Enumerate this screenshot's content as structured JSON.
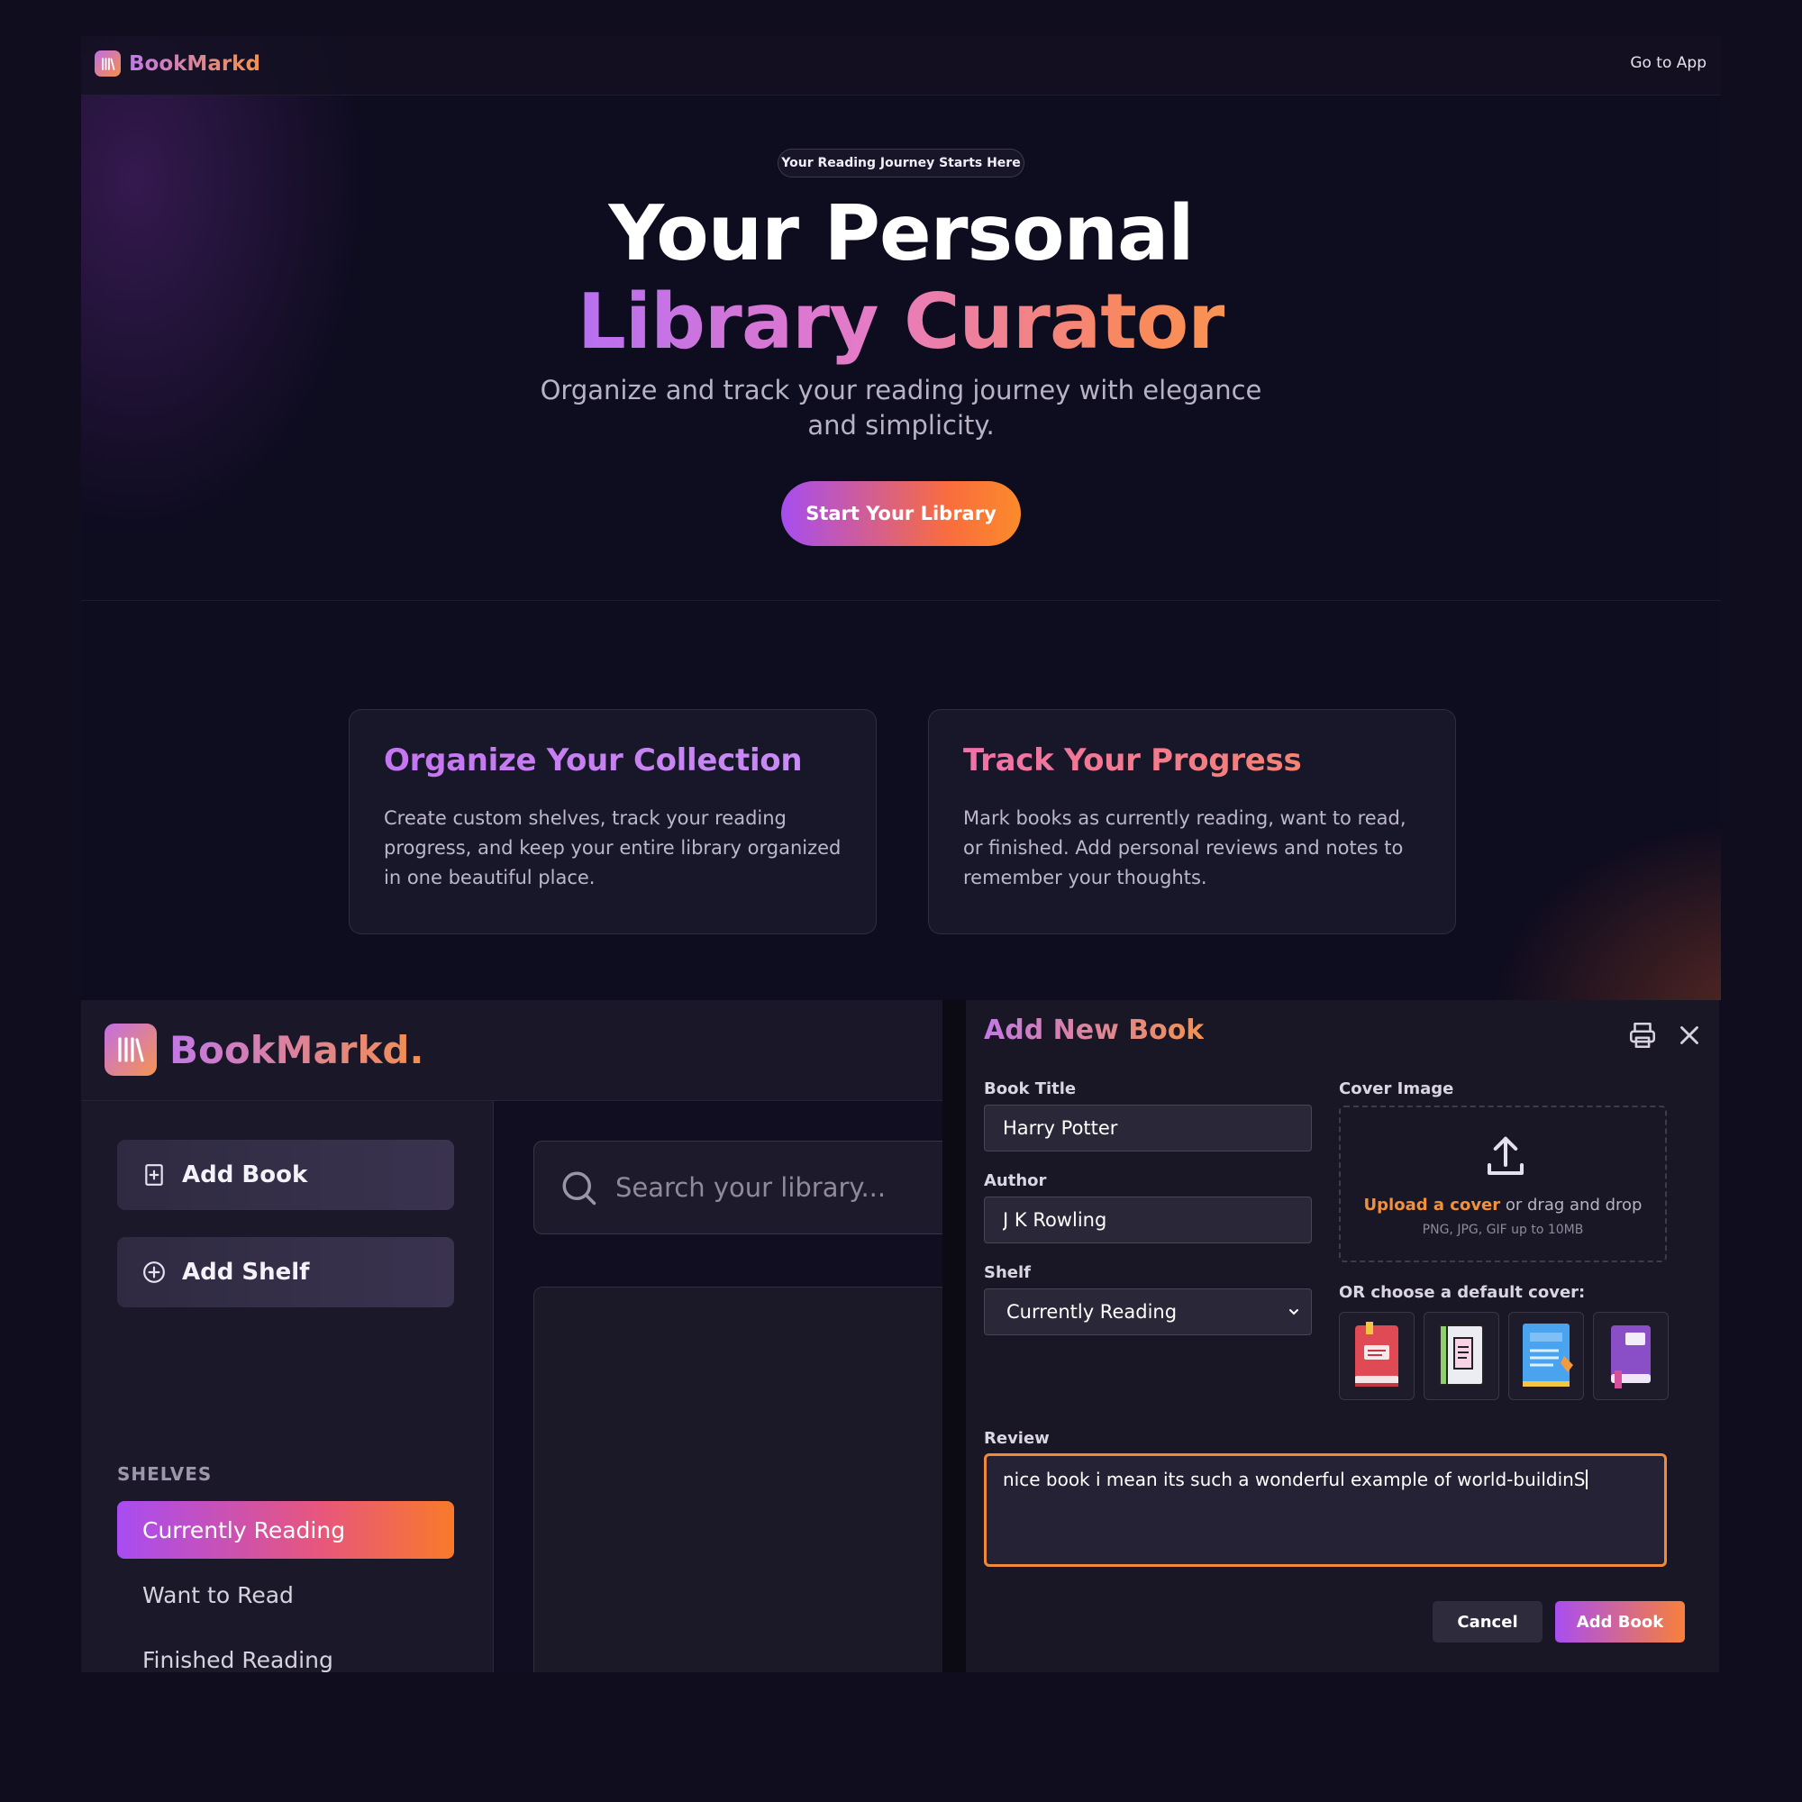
{
  "landing": {
    "brand": "BookMarkd",
    "nav_link": "Go to App",
    "badge": "Your Reading Journey Starts Here",
    "hero_line1": "Your Personal",
    "hero_line2": "Library Curator",
    "subtitle": "Organize and track your reading journey with elegance and simplicity.",
    "cta": "Start Your Library",
    "features": [
      {
        "title": "Organize Your Collection",
        "body": "Create custom shelves, track your reading progress, and keep your entire library organized in one beautiful place."
      },
      {
        "title": "Track Your Progress",
        "body": "Mark books as currently reading, want to read, or finished. Add personal reviews and notes to remember your thoughts."
      }
    ]
  },
  "app": {
    "brand": "BookMarkd.",
    "sidebar": {
      "add_book": "Add Book",
      "add_shelf": "Add Shelf",
      "shelves_label": "SHELVES",
      "shelves": [
        "Currently Reading",
        "Want to Read",
        "Finished Reading"
      ],
      "active_shelf": "Currently Reading"
    },
    "search": {
      "placeholder": "Search your library..."
    }
  },
  "modal": {
    "title": "Add New Book",
    "book_title_label": "Book Title",
    "book_title_value": "Harry Potter",
    "author_label": "Author",
    "author_value": "J K Rowling",
    "shelf_label": "Shelf",
    "shelf_value": "Currently Reading",
    "cover_label": "Cover Image",
    "upload_link": "Upload a cover",
    "upload_rest": " or drag and drop",
    "upload_hint": "PNG, JPG, GIF up to 10MB",
    "default_cover_label": "OR choose a default cover:",
    "default_covers": [
      "red-book-icon",
      "scroll-book-icon",
      "blue-notebook-icon",
      "purple-book-icon"
    ],
    "review_label": "Review",
    "review_value": "nice book i mean its such a wonderful example of world-buildinS",
    "cancel": "Cancel",
    "submit": "Add Book"
  },
  "colors": {
    "accent_purple": "#a84cf2",
    "accent_orange": "#f97a2a",
    "background": "#0f0d1e"
  }
}
